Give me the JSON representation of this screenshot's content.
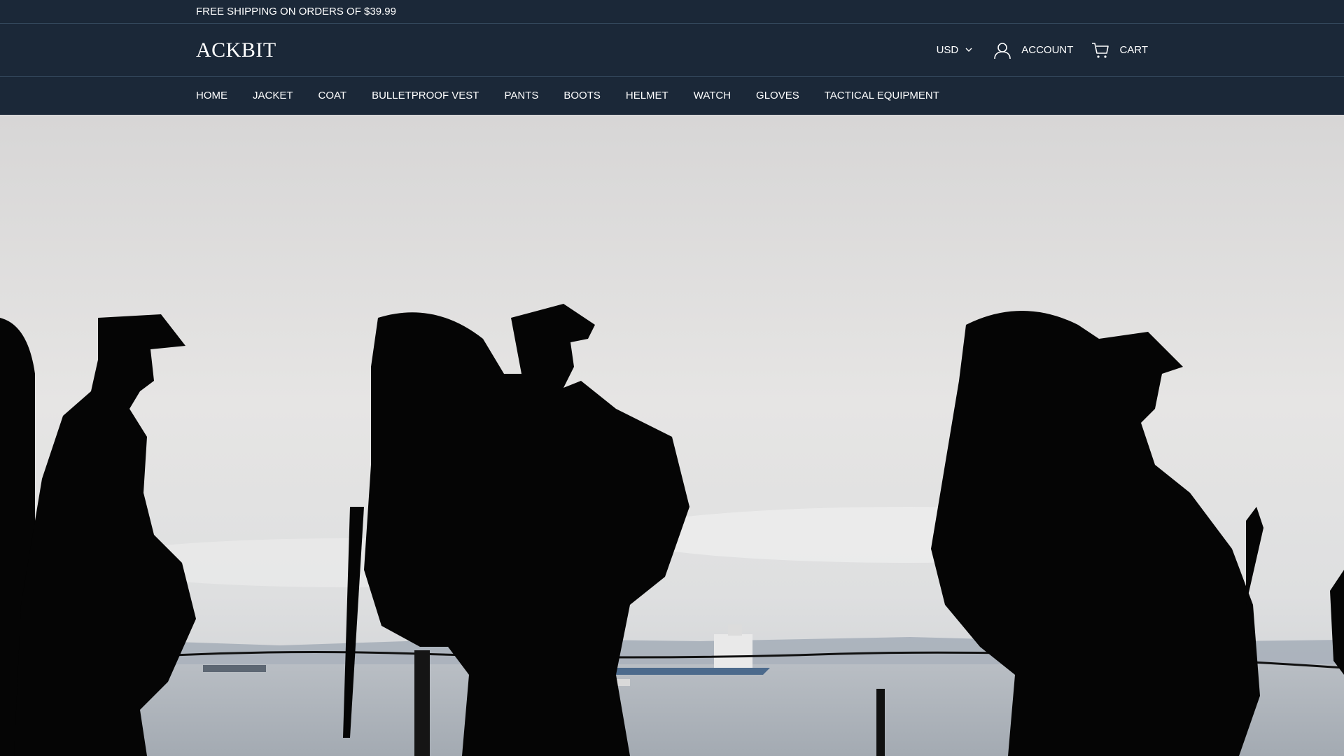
{
  "announcement": {
    "text": "FREE SHIPPING ON ORDERS OF $39.99"
  },
  "header": {
    "logo": "ACKBIT",
    "currency": "USD",
    "account_label": "ACCOUNT",
    "cart_label": "CART"
  },
  "nav": {
    "items": [
      {
        "label": "HOME"
      },
      {
        "label": "JACKET"
      },
      {
        "label": "COAT"
      },
      {
        "label": "BULLETPROOF VEST"
      },
      {
        "label": "PANTS"
      },
      {
        "label": "BOOTS"
      },
      {
        "label": "HELMET"
      },
      {
        "label": "WATCH"
      },
      {
        "label": "GLOVES"
      },
      {
        "label": "TACTICAL EQUIPMENT"
      }
    ]
  },
  "colors": {
    "header_bg": "#1b2838",
    "text": "#ffffff",
    "sky": "#e4e3e3",
    "silhouette": "#050505"
  },
  "icons": {
    "currency": "chevron-down-icon",
    "account": "user-icon",
    "cart": "cart-icon"
  }
}
